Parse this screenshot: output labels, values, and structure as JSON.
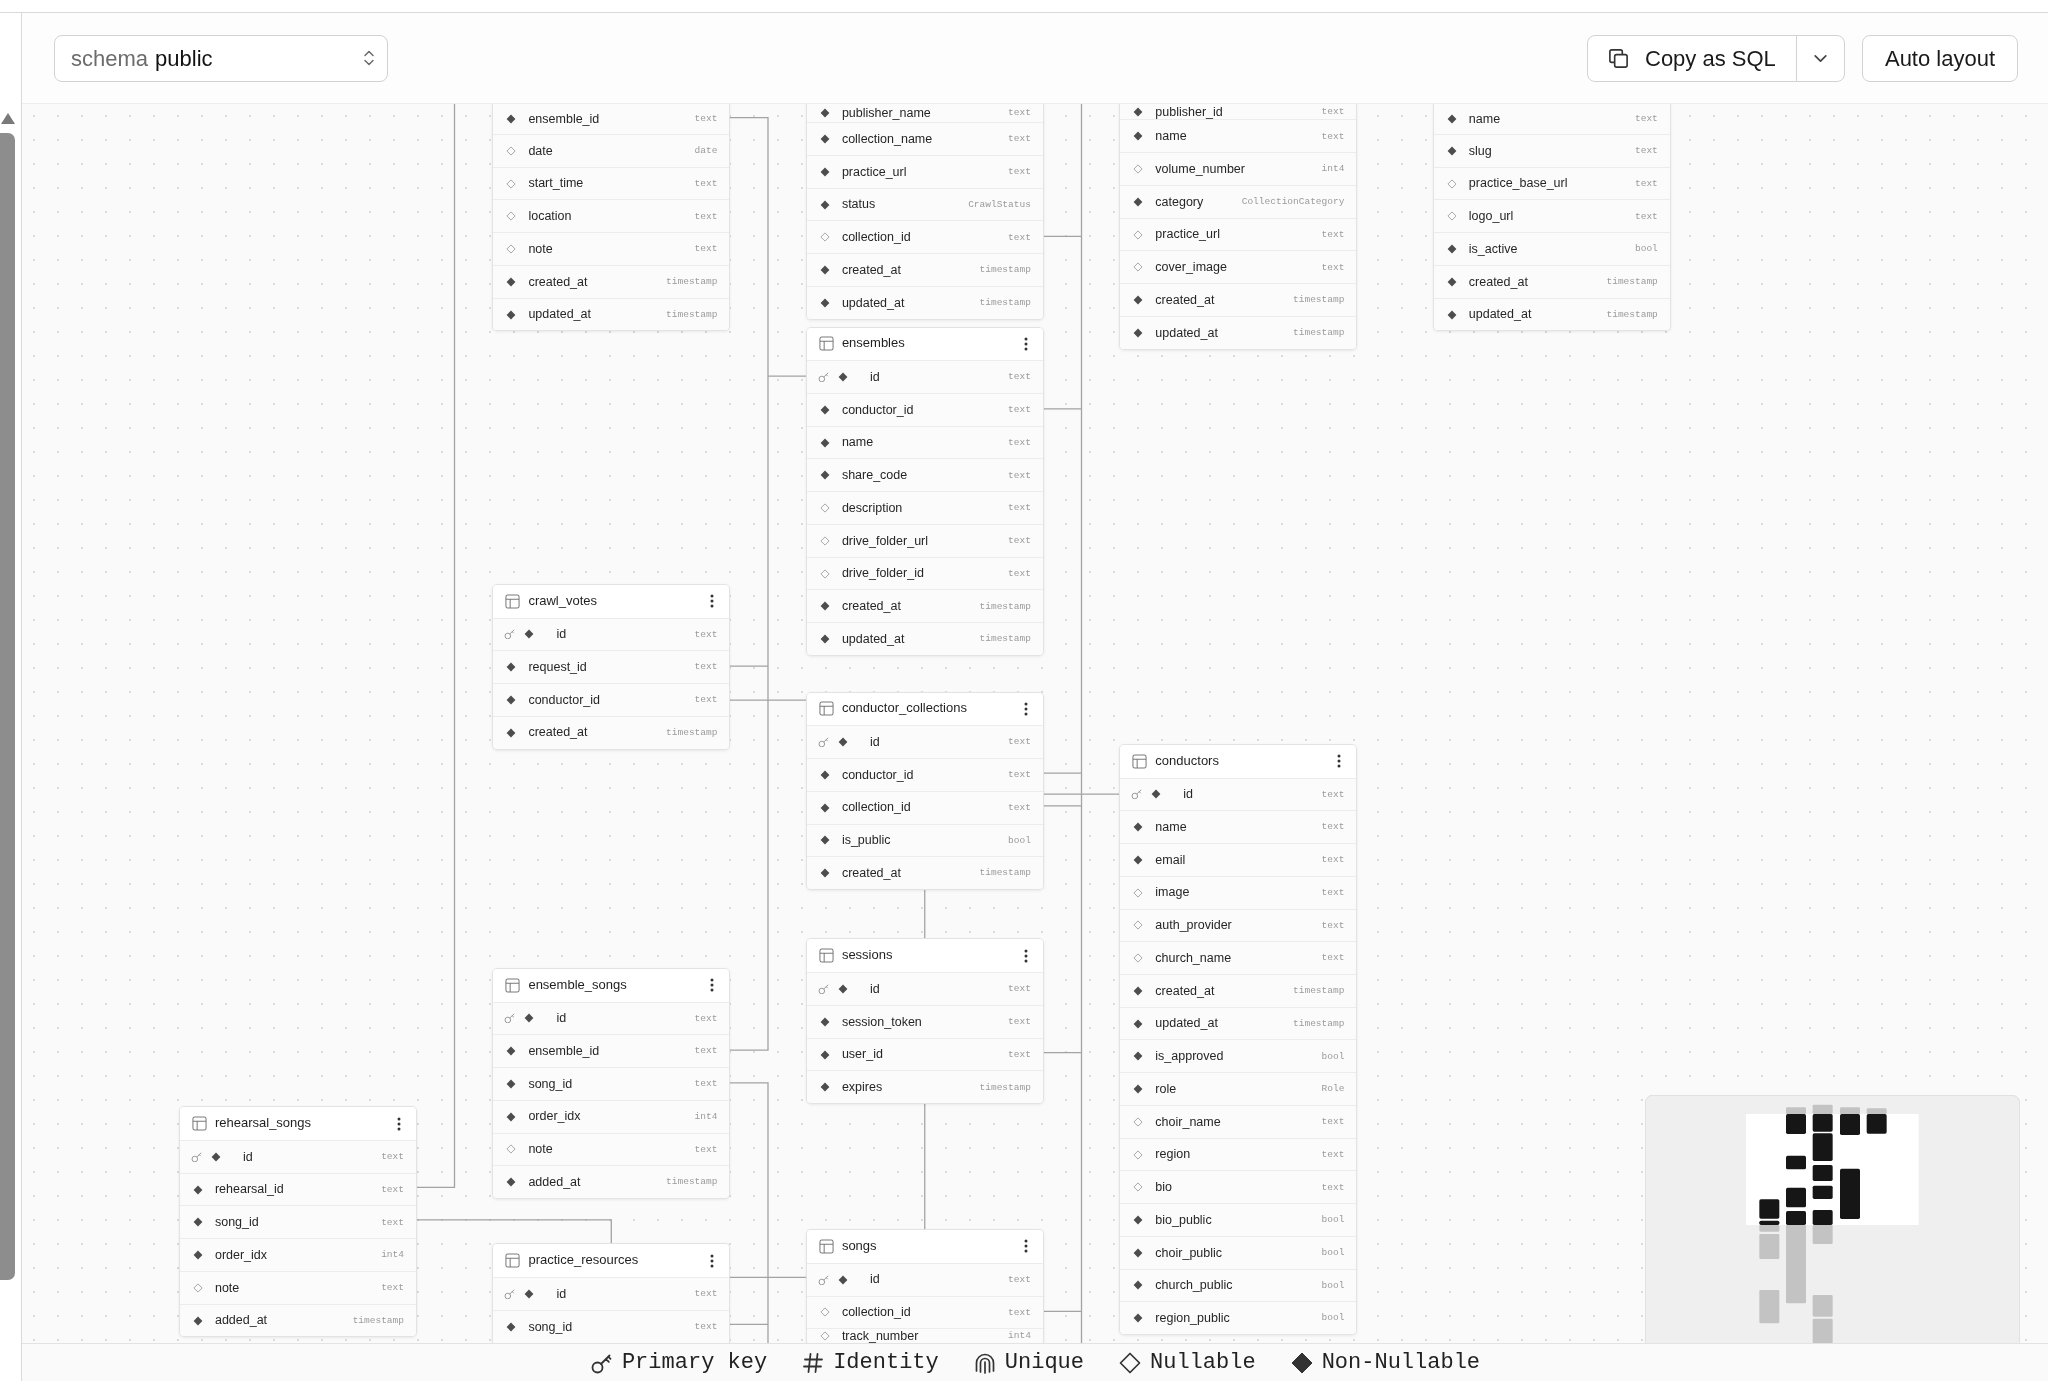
{
  "toolbar": {
    "schema_select": {
      "label": "schema",
      "value": "public"
    },
    "copy_button": {
      "label": "Copy as SQL"
    },
    "auto_layout_button": {
      "label": "Auto layout"
    }
  },
  "tables": [
    {
      "columns": [
        {
          "name": "ensemble_id",
          "type": "text",
          "primary_key": false,
          "nullable": false
        },
        {
          "name": "date",
          "type": "date",
          "primary_key": false,
          "nullable": true
        },
        {
          "name": "start_time",
          "type": "text",
          "primary_key": false,
          "nullable": true
        },
        {
          "name": "location",
          "type": "text",
          "primary_key": false,
          "nullable": true
        },
        {
          "name": "note",
          "type": "text",
          "primary_key": false,
          "nullable": true
        },
        {
          "name": "created_at",
          "type": "timestamp",
          "primary_key": false,
          "nullable": false
        },
        {
          "name": "updated_at",
          "type": "timestamp",
          "primary_key": false,
          "nullable": false
        }
      ]
    },
    {
      "columns": [
        {
          "name": "publisher_name",
          "type": "text",
          "primary_key": false,
          "nullable": false
        },
        {
          "name": "collection_name",
          "type": "text",
          "primary_key": false,
          "nullable": false
        },
        {
          "name": "practice_url",
          "type": "text",
          "primary_key": false,
          "nullable": false
        },
        {
          "name": "status",
          "type": "CrawlStatus",
          "primary_key": false,
          "nullable": false
        },
        {
          "name": "collection_id",
          "type": "text",
          "primary_key": false,
          "nullable": true
        },
        {
          "name": "created_at",
          "type": "timestamp",
          "primary_key": false,
          "nullable": false
        },
        {
          "name": "updated_at",
          "type": "timestamp",
          "primary_key": false,
          "nullable": false
        }
      ]
    },
    {
      "columns": [
        {
          "name": "publisher_id",
          "type": "text",
          "primary_key": false,
          "nullable": false
        },
        {
          "name": "name",
          "type": "text",
          "primary_key": false,
          "nullable": false
        },
        {
          "name": "volume_number",
          "type": "int4",
          "primary_key": false,
          "nullable": true
        },
        {
          "name": "category",
          "type": "CollectionCategory",
          "primary_key": false,
          "nullable": false
        },
        {
          "name": "practice_url",
          "type": "text",
          "primary_key": false,
          "nullable": true
        },
        {
          "name": "cover_image",
          "type": "text",
          "primary_key": false,
          "nullable": true
        },
        {
          "name": "created_at",
          "type": "timestamp",
          "primary_key": false,
          "nullable": false
        },
        {
          "name": "updated_at",
          "type": "timestamp",
          "primary_key": false,
          "nullable": false
        }
      ]
    },
    {
      "columns": [
        {
          "name": "name",
          "type": "text",
          "primary_key": false,
          "nullable": false
        },
        {
          "name": "slug",
          "type": "text",
          "primary_key": false,
          "nullable": false
        },
        {
          "name": "practice_base_url",
          "type": "text",
          "primary_key": false,
          "nullable": true
        },
        {
          "name": "logo_url",
          "type": "text",
          "primary_key": false,
          "nullable": true
        },
        {
          "name": "is_active",
          "type": "bool",
          "primary_key": false,
          "nullable": false
        },
        {
          "name": "created_at",
          "type": "timestamp",
          "primary_key": false,
          "nullable": false
        },
        {
          "name": "updated_at",
          "type": "timestamp",
          "primary_key": false,
          "nullable": false
        }
      ]
    },
    {
      "name": "ensembles",
      "columns": [
        {
          "name": "id",
          "type": "text",
          "primary_key": true,
          "nullable": false
        },
        {
          "name": "conductor_id",
          "type": "text",
          "primary_key": false,
          "nullable": false
        },
        {
          "name": "name",
          "type": "text",
          "primary_key": false,
          "nullable": false
        },
        {
          "name": "share_code",
          "type": "text",
          "primary_key": false,
          "nullable": false
        },
        {
          "name": "description",
          "type": "text",
          "primary_key": false,
          "nullable": true
        },
        {
          "name": "drive_folder_url",
          "type": "text",
          "primary_key": false,
          "nullable": true
        },
        {
          "name": "drive_folder_id",
          "type": "text",
          "primary_key": false,
          "nullable": true
        },
        {
          "name": "created_at",
          "type": "timestamp",
          "primary_key": false,
          "nullable": false
        },
        {
          "name": "updated_at",
          "type": "timestamp",
          "primary_key": false,
          "nullable": false
        }
      ]
    },
    {
      "name": "crawl_votes",
      "columns": [
        {
          "name": "id",
          "type": "text",
          "primary_key": true,
          "nullable": false
        },
        {
          "name": "request_id",
          "type": "text",
          "primary_key": false,
          "nullable": false
        },
        {
          "name": "conductor_id",
          "type": "text",
          "primary_key": false,
          "nullable": false
        },
        {
          "name": "created_at",
          "type": "timestamp",
          "primary_key": false,
          "nullable": false
        }
      ]
    },
    {
      "name": "conductor_collections",
      "columns": [
        {
          "name": "id",
          "type": "text",
          "primary_key": true,
          "nullable": false
        },
        {
          "name": "conductor_id",
          "type": "text",
          "primary_key": false,
          "nullable": false
        },
        {
          "name": "collection_id",
          "type": "text",
          "primary_key": false,
          "nullable": false
        },
        {
          "name": "is_public",
          "type": "bool",
          "primary_key": false,
          "nullable": false
        },
        {
          "name": "created_at",
          "type": "timestamp",
          "primary_key": false,
          "nullable": false
        }
      ]
    },
    {
      "name": "conductors",
      "columns": [
        {
          "name": "id",
          "type": "text",
          "primary_key": true,
          "nullable": false
        },
        {
          "name": "name",
          "type": "text",
          "primary_key": false,
          "nullable": false
        },
        {
          "name": "email",
          "type": "text",
          "primary_key": false,
          "nullable": false
        },
        {
          "name": "image",
          "type": "text",
          "primary_key": false,
          "nullable": true
        },
        {
          "name": "auth_provider",
          "type": "text",
          "primary_key": false,
          "nullable": true
        },
        {
          "name": "church_name",
          "type": "text",
          "primary_key": false,
          "nullable": true
        },
        {
          "name": "created_at",
          "type": "timestamp",
          "primary_key": false,
          "nullable": false
        },
        {
          "name": "updated_at",
          "type": "timestamp",
          "primary_key": false,
          "nullable": false
        },
        {
          "name": "is_approved",
          "type": "bool",
          "primary_key": false,
          "nullable": false
        },
        {
          "name": "role",
          "type": "Role",
          "primary_key": false,
          "nullable": false
        },
        {
          "name": "choir_name",
          "type": "text",
          "primary_key": false,
          "nullable": true
        },
        {
          "name": "region",
          "type": "text",
          "primary_key": false,
          "nullable": true
        },
        {
          "name": "bio",
          "type": "text",
          "primary_key": false,
          "nullable": true
        },
        {
          "name": "bio_public",
          "type": "bool",
          "primary_key": false,
          "nullable": false
        },
        {
          "name": "choir_public",
          "type": "bool",
          "primary_key": false,
          "nullable": false
        },
        {
          "name": "church_public",
          "type": "bool",
          "primary_key": false,
          "nullable": false
        },
        {
          "name": "region_public",
          "type": "bool",
          "primary_key": false,
          "nullable": false
        }
      ]
    },
    {
      "name": "sessions",
      "columns": [
        {
          "name": "id",
          "type": "text",
          "primary_key": true,
          "nullable": false
        },
        {
          "name": "session_token",
          "type": "text",
          "primary_key": false,
          "nullable": false
        },
        {
          "name": "user_id",
          "type": "text",
          "primary_key": false,
          "nullable": false
        },
        {
          "name": "expires",
          "type": "timestamp",
          "primary_key": false,
          "nullable": false
        }
      ]
    },
    {
      "name": "ensemble_songs",
      "columns": [
        {
          "name": "id",
          "type": "text",
          "primary_key": true,
          "nullable": false
        },
        {
          "name": "ensemble_id",
          "type": "text",
          "primary_key": false,
          "nullable": false
        },
        {
          "name": "song_id",
          "type": "text",
          "primary_key": false,
          "nullable": false
        },
        {
          "name": "order_idx",
          "type": "int4",
          "primary_key": false,
          "nullable": false
        },
        {
          "name": "note",
          "type": "text",
          "primary_key": false,
          "nullable": true
        },
        {
          "name": "added_at",
          "type": "timestamp",
          "primary_key": false,
          "nullable": false
        }
      ]
    },
    {
      "name": "rehearsal_songs",
      "columns": [
        {
          "name": "id",
          "type": "text",
          "primary_key": true,
          "nullable": false
        },
        {
          "name": "rehearsal_id",
          "type": "text",
          "primary_key": false,
          "nullable": false
        },
        {
          "name": "song_id",
          "type": "text",
          "primary_key": false,
          "nullable": false
        },
        {
          "name": "order_idx",
          "type": "int4",
          "primary_key": false,
          "nullable": false
        },
        {
          "name": "note",
          "type": "text",
          "primary_key": false,
          "nullable": true
        },
        {
          "name": "added_at",
          "type": "timestamp",
          "primary_key": false,
          "nullable": false
        }
      ]
    },
    {
      "name": "practice_resources",
      "columns": [
        {
          "name": "id",
          "type": "text",
          "primary_key": true,
          "nullable": false
        },
        {
          "name": "song_id",
          "type": "text",
          "primary_key": false,
          "nullable": false
        }
      ]
    },
    {
      "name": "songs",
      "columns": [
        {
          "name": "id",
          "type": "text",
          "primary_key": true,
          "nullable": false
        },
        {
          "name": "collection_id",
          "type": "text",
          "primary_key": false,
          "nullable": true
        },
        {
          "name": "track_number",
          "type": "int4",
          "primary_key": false,
          "nullable": true
        }
      ]
    }
  ],
  "legend": [
    {
      "kind": "primary_key",
      "label": "Primary key"
    },
    {
      "kind": "identity",
      "label": "Identity"
    },
    {
      "kind": "unique",
      "label": "Unique"
    },
    {
      "kind": "nullable",
      "label": "Nullable"
    },
    {
      "kind": "non_nullable",
      "label": "Non-Nullable"
    }
  ]
}
